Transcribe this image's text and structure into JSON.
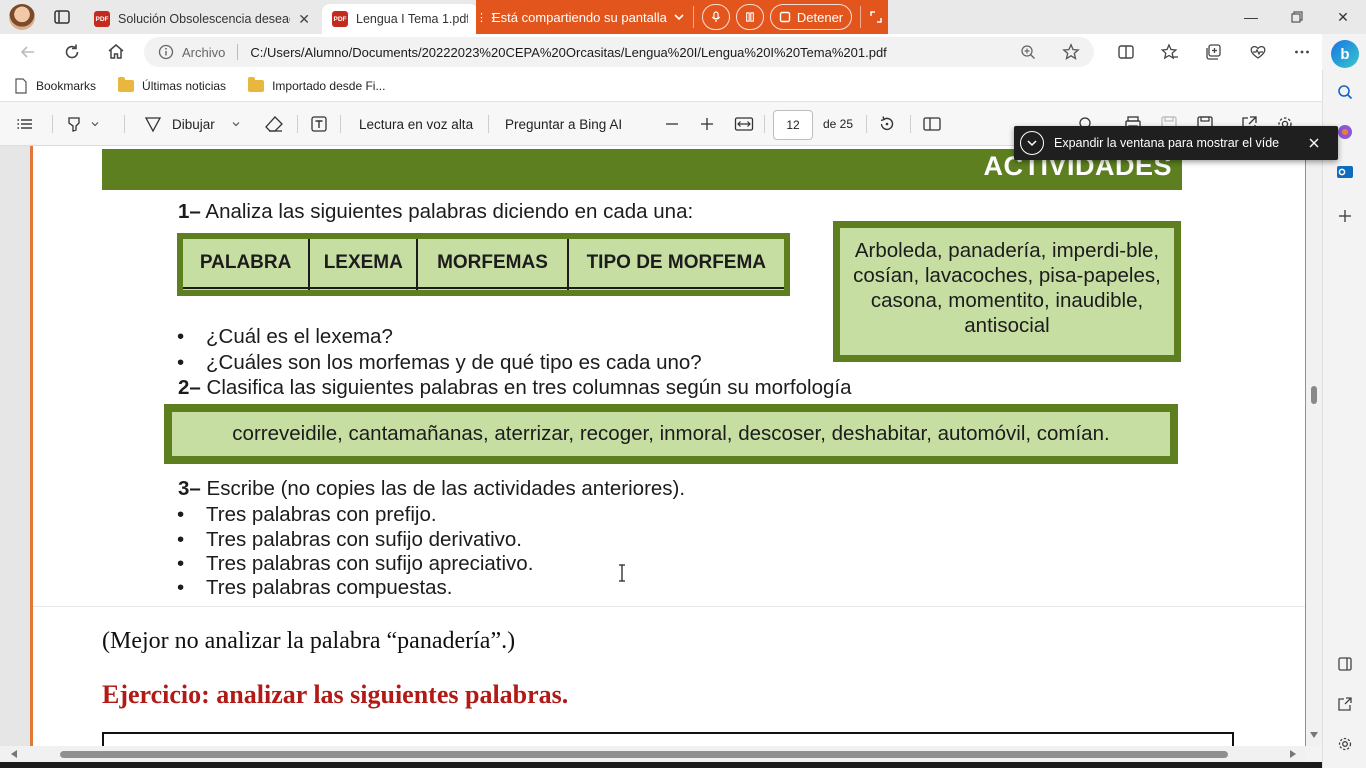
{
  "browser": {
    "tabs": [
      {
        "title": "Solución Obsolescencia deseada",
        "icon": "pdf-icon",
        "active": false
      },
      {
        "title": "Lengua I Tema 1.pdf",
        "icon": "pdf-icon",
        "active": true
      }
    ],
    "pdf_icon_text": "PDF",
    "sharing": {
      "label": "Está compartiendo su pantalla",
      "stop_label": "Detener"
    },
    "address": {
      "scheme_label": "Archivo",
      "url": "C:/Users/Alumno/Documents/20222023%20CEPA%20Orcasitas/Lengua%20I/Lengua%20I%20Tema%201.pdf"
    },
    "bookmarks": [
      "Bookmarks",
      "Últimas noticias",
      "Importado desde Fi..."
    ]
  },
  "pdf_toolbar": {
    "draw_label": "Dibujar",
    "read_aloud_label": "Lectura en voz alta",
    "ask_bing_label": "Preguntar a Bing AI",
    "page_current": "12",
    "page_total_label": "de 25"
  },
  "notification": {
    "text": "Expandir la ventana para mostrar el víde"
  },
  "document": {
    "banner_title": "ACTIVIDADES",
    "q1": {
      "number": "1–",
      "text": "Analiza las siguientes palabras diciendo en cada una:"
    },
    "table_headers": [
      "PALABRA",
      "LEXEMA",
      "MORFEMAS",
      "TIPO DE MORFEMA"
    ],
    "word_box_1": "Arboleda, panadería, imperdi-ble, cosían, lavacoches, pisa-papeles, casona, momentito, inaudible, antisocial",
    "q1_bullets": [
      "¿Cuál es el lexema?",
      "¿Cuáles son los morfemas y de qué tipo es cada uno?"
    ],
    "q2": {
      "number": "2–",
      "text": "Clasifica las siguientes palabras en tres columnas según su morfología"
    },
    "word_box_2": "correveidile, cantamañanas, aterrizar, recoger, inmoral, descoser, deshabitar, automóvil, comían.",
    "q3": {
      "number": "3–",
      "text": "Escribe (no copies las de las actividades anteriores)."
    },
    "q3_bullets": [
      "Tres palabras con prefijo.",
      "Tres palabras con sufijo derivativo.",
      "Tres palabras con sufijo apreciativo.",
      "Tres palabras compuestas."
    ],
    "note": "(Mejor no analizar la palabra “panadería”.)",
    "exercise_title": "Ejercicio: analizar las siguientes palabras."
  },
  "colors": {
    "share_bar": "#e2561e",
    "banner_green": "#5d7f20",
    "box_fill": "#c7dea3",
    "exercise_red": "#b11a16",
    "page_border": "#e07a3a"
  }
}
